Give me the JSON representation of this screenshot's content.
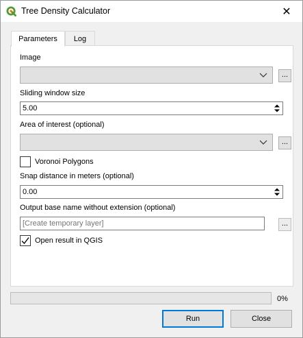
{
  "window": {
    "title": "Tree Density Calculator",
    "icon": "qgis-logo-icon",
    "close_glyph": "✕"
  },
  "tabs": [
    {
      "label": "Parameters",
      "active": true
    },
    {
      "label": "Log",
      "active": false
    }
  ],
  "params": {
    "image_label": "Image",
    "image_value": "",
    "sliding_label": "Sliding window size",
    "sliding_value": "5.00",
    "aoi_label": "Area of interest (optional)",
    "aoi_value": "",
    "voronoi_label": "Voronoi Polygons",
    "voronoi_checked": false,
    "snap_label": "Snap distance in meters (optional)",
    "snap_value": "0.00",
    "output_label": "Output base name without extension (optional)",
    "output_placeholder": "[Create temporary layer]",
    "open_label": "Open result in QGIS",
    "open_checked": true,
    "browse_label": "..."
  },
  "footer": {
    "progress": 0,
    "progress_text": "0%",
    "run_label": "Run",
    "close_label": "Close"
  },
  "colors": {
    "accent": "#0078d7",
    "qgis_green": "#589632",
    "qgis_yellow": "#ee7913"
  }
}
